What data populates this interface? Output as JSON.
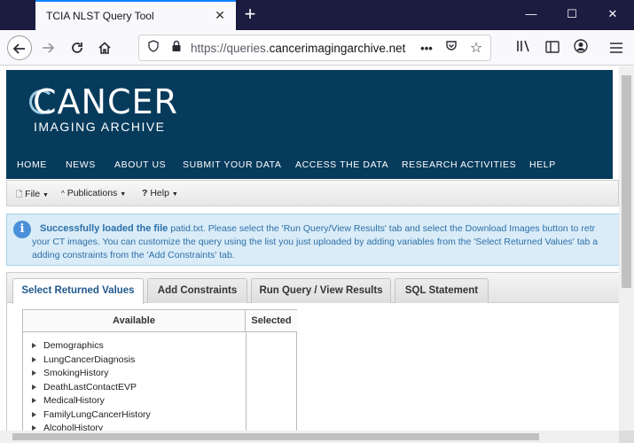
{
  "browser": {
    "tab_title": "TCIA NLST Query Tool",
    "tab_close": "✕",
    "new_tab": "+",
    "url_prefix": "https://queries.",
    "url_domain": "cancerimagingarchive.net",
    "window_buttons": [
      "—",
      "☐",
      "✕"
    ]
  },
  "site": {
    "logo_main": "CANCER",
    "logo_sub": "IMAGING ARCHIVE",
    "nav": [
      "HOME",
      "NEWS",
      "ABOUT US",
      "SUBMIT YOUR DATA",
      "ACCESS THE DATA",
      "RESEARCH ACTIVITIES",
      "HELP"
    ]
  },
  "menubar": {
    "file": "File",
    "publications": "Publications",
    "help": "Help"
  },
  "message": {
    "strong": "Successfully loaded the file",
    "line1": " patid.txt. Please select the 'Run Query/View Results' tab and select the Download Images button to retr",
    "line2": "your CT images. You can customize the query using the list you just uploaded by adding variables from the 'Select Returned Values' tab a",
    "line3": "adding constraints from the 'Add Constraints' tab."
  },
  "query_tabs": [
    "Select Returned Values",
    "Add Constraints",
    "Run Query / View Results",
    "SQL Statement"
  ],
  "table": {
    "available_header": "Available",
    "selected_header": "Selected",
    "items": [
      "Demographics",
      "LungCancerDiagnosis",
      "SmokingHistory",
      "DeathLastContactEVP",
      "MedicalHistory",
      "FamilyLungCancerHistory",
      "AlcoholHistory"
    ]
  },
  "colors": {
    "banner": "#073b5c",
    "titlebar": "#1c1b40",
    "message_bg": "#d9ecf7",
    "message_text": "#2d6fa8",
    "active_tab_text": "#215a8d"
  }
}
